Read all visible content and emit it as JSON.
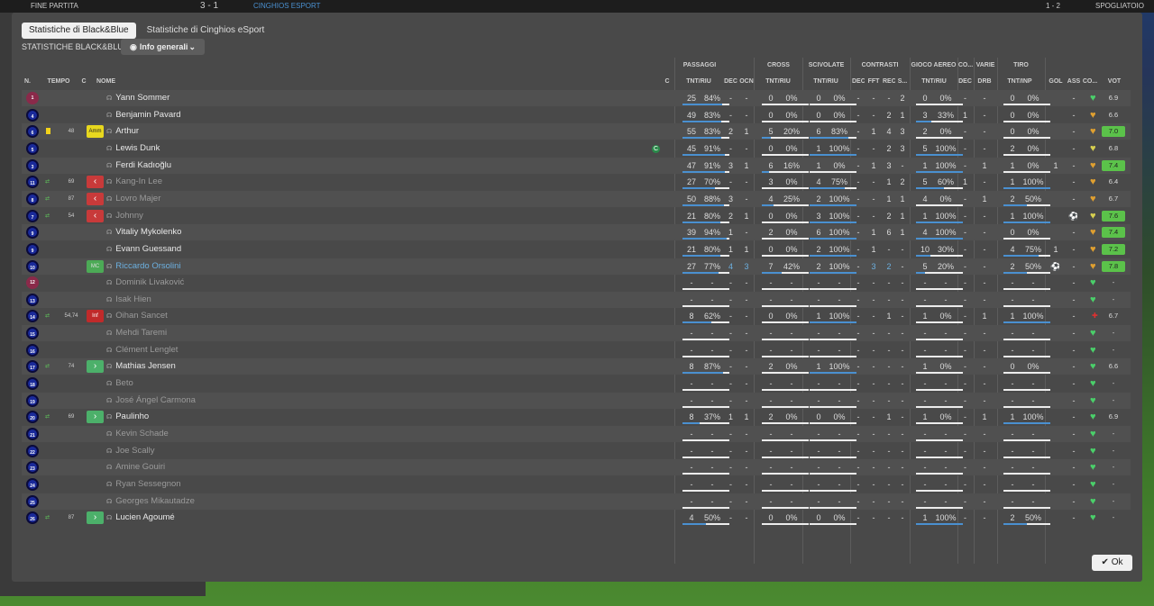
{
  "topbar": {
    "left": "FINE PARTITA",
    "score": "3 - 1",
    "team2": "CINGHIOS ESPORT",
    "sep": "1 - 2",
    "right": "SPOGLIATOIO"
  },
  "tabs": [
    "Statistiche di Black&Blue",
    "Statistiche di Cinghios eSport"
  ],
  "subtitle": "STATISTICHE BLACK&BLUE",
  "dropdown": "Info generali",
  "group_headers": {
    "passaggi": "PASSAGGI",
    "cross": "CROSS",
    "scivolate": "SCIVOLATE",
    "contrasti": "CONTRASTI",
    "gioco_aereo": "GIOCO AEREO",
    "co": "CO...",
    "varie": "VARIE",
    "tiro": "TIRO"
  },
  "headers": {
    "n": "N.",
    "tempo": "TEMPO",
    "c1": "C",
    "nome": "NOME",
    "c2": "C",
    "pass": "TNT/RIU",
    "dec": "DEC",
    "ocn": "OCN",
    "cross": "TNT/RIU",
    "sciv": "TNT/RIU",
    "cdec": "DEC",
    "fft": "FFT",
    "rec": "REC",
    "s": "S...",
    "aer": "TNT/RIU",
    "adec": "DEC",
    "drb": "DRB",
    "tiro": "TNT/INP",
    "gol": "GOL",
    "ass": "ASS",
    "co": "CO...",
    "vot": "VOT"
  },
  "ok_label": "Ok",
  "players": [
    {
      "n": "1",
      "name": "Yann Sommer",
      "kind": "gk",
      "pass": [
        "25",
        "84%"
      ],
      "dec": "-",
      "ocn": "-",
      "cross": [
        "0",
        "0%"
      ],
      "sciv": [
        "0",
        "0%"
      ],
      "cdec": "-",
      "fft": "-",
      "rec": "-",
      "s": "2",
      "aer": [
        "0",
        "0%"
      ],
      "adec": "-",
      "drb": "-",
      "tiro": [
        "0",
        "0%"
      ],
      "gol": "",
      "ass": "-",
      "heart": "green",
      "vote": "6.9",
      "hi": false
    },
    {
      "n": "4",
      "name": "Benjamin Pavard",
      "kind": "out",
      "pass": [
        "49",
        "83%"
      ],
      "dec": "-",
      "ocn": "-",
      "cross": [
        "0",
        "0%"
      ],
      "sciv": [
        "0",
        "0%"
      ],
      "cdec": "-",
      "fft": "-",
      "rec": "2",
      "s": "1",
      "aer": [
        "3",
        "33%"
      ],
      "adec": "1",
      "drb": "-",
      "tiro": [
        "0",
        "0%"
      ],
      "gol": "",
      "ass": "-",
      "heart": "orange",
      "vote": "6.6",
      "hi": false
    },
    {
      "n": "6",
      "name": "Arthur",
      "kind": "out",
      "yellow": true,
      "tm": "48",
      "badge": "Amm",
      "badgeType": "amm",
      "pass": [
        "55",
        "83%"
      ],
      "dec": "2",
      "ocn": "1",
      "cross": [
        "5",
        "20%"
      ],
      "sciv": [
        "6",
        "83%"
      ],
      "cdec": "-",
      "fft": "1",
      "rec": "4",
      "s": "3",
      "aer": [
        "2",
        "0%"
      ],
      "adec": "-",
      "drb": "-",
      "tiro": [
        "0",
        "0%"
      ],
      "gol": "",
      "ass": "-",
      "heart": "orange",
      "vote": "7.0",
      "hi": true
    },
    {
      "n": "5",
      "name": "Lewis Dunk",
      "kind": "out",
      "capt": "C",
      "pass": [
        "45",
        "91%"
      ],
      "dec": "-",
      "ocn": "-",
      "cross": [
        "0",
        "0%"
      ],
      "sciv": [
        "1",
        "100%"
      ],
      "cdec": "-",
      "fft": "-",
      "rec": "2",
      "s": "3",
      "aer": [
        "5",
        "100%"
      ],
      "adec": "-",
      "drb": "-",
      "tiro": [
        "2",
        "0%"
      ],
      "gol": "",
      "ass": "-",
      "heart": "yellow",
      "vote": "6.8",
      "hi": false
    },
    {
      "n": "3",
      "name": "Ferdi Kadıoğlu",
      "kind": "out",
      "pass": [
        "47",
        "91%"
      ],
      "dec": "3",
      "ocn": "1",
      "cross": [
        "6",
        "16%"
      ],
      "sciv": [
        "1",
        "0%"
      ],
      "cdec": "-",
      "fft": "1",
      "rec": "3",
      "s": "-",
      "aer": [
        "1",
        "100%"
      ],
      "adec": "-",
      "drb": "1",
      "tiro": [
        "1",
        "0%"
      ],
      "gol": "1",
      "ass": "-",
      "heart": "orange",
      "vote": "7.4",
      "hi": true
    },
    {
      "n": "11",
      "name": "Kang-In Lee",
      "kind": "out",
      "sub": true,
      "swap": true,
      "tm": "69",
      "badgeType": "out",
      "badge": "‹",
      "pass": [
        "27",
        "70%"
      ],
      "dec": "-",
      "ocn": "-",
      "cross": [
        "3",
        "0%"
      ],
      "sciv": [
        "4",
        "75%"
      ],
      "cdec": "-",
      "fft": "-",
      "rec": "1",
      "s": "2",
      "aer": [
        "5",
        "60%"
      ],
      "adec": "1",
      "drb": "-",
      "tiro": [
        "1",
        "100%"
      ],
      "gol": "",
      "ass": "-",
      "heart": "orange",
      "vote": "6.4",
      "hi": false
    },
    {
      "n": "8",
      "name": "Lovro Majer",
      "kind": "out",
      "sub": true,
      "swap": true,
      "tm": "87",
      "badgeType": "out",
      "badge": "‹",
      "pass": [
        "50",
        "88%"
      ],
      "dec": "3",
      "ocn": "-",
      "cross": [
        "4",
        "25%"
      ],
      "sciv": [
        "2",
        "100%"
      ],
      "cdec": "-",
      "fft": "-",
      "rec": "1",
      "s": "1",
      "aer": [
        "4",
        "0%"
      ],
      "adec": "-",
      "drb": "1",
      "tiro": [
        "2",
        "50%"
      ],
      "gol": "",
      "ass": "-",
      "heart": "orange",
      "vote": "6.7",
      "hi": false
    },
    {
      "n": "7",
      "name": "Johnny",
      "kind": "out",
      "sub": true,
      "swap": true,
      "tm": "54",
      "badgeType": "out",
      "badge": "‹",
      "pass": [
        "21",
        "80%"
      ],
      "dec": "2",
      "ocn": "1",
      "cross": [
        "0",
        "0%"
      ],
      "sciv": [
        "3",
        "100%"
      ],
      "cdec": "-",
      "fft": "-",
      "rec": "2",
      "s": "1",
      "aer": [
        "1",
        "100%"
      ],
      "adec": "-",
      "drb": "-",
      "tiro": [
        "1",
        "100%"
      ],
      "gol": "",
      "ass": "⚽",
      "heart": "yellow",
      "vote": "7.6",
      "hi": true
    },
    {
      "n": "9",
      "name": "Vitaliy Mykolenko",
      "kind": "out",
      "pass": [
        "39",
        "94%"
      ],
      "dec": "1",
      "ocn": "-",
      "cross": [
        "2",
        "0%"
      ],
      "sciv": [
        "6",
        "100%"
      ],
      "cdec": "-",
      "fft": "1",
      "rec": "6",
      "s": "1",
      "aer": [
        "4",
        "100%"
      ],
      "adec": "-",
      "drb": "-",
      "tiro": [
        "0",
        "0%"
      ],
      "gol": "",
      "ass": "-",
      "heart": "orange",
      "vote": "7.4",
      "hi": true
    },
    {
      "n": "9",
      "name": "Evann Guessand",
      "kind": "out",
      "pass": [
        "21",
        "80%"
      ],
      "dec": "1",
      "ocn": "1",
      "cross": [
        "0",
        "0%"
      ],
      "sciv": [
        "2",
        "100%"
      ],
      "cdec": "-",
      "fft": "1",
      "rec": "-",
      "s": "-",
      "aer": [
        "10",
        "30%"
      ],
      "adec": "-",
      "drb": "-",
      "tiro": [
        "4",
        "75%"
      ],
      "gol": "1",
      "ass": "-",
      "heart": "orange",
      "vote": "7.2",
      "hi": true
    },
    {
      "n": "10",
      "name": "Riccardo Orsolini",
      "kind": "out",
      "hl": true,
      "badgeType": "mc",
      "badge": "MC",
      "pass": [
        "27",
        "77%"
      ],
      "dec": "4",
      "ocn": "3",
      "cross": [
        "7",
        "42%"
      ],
      "sciv": [
        "2",
        "100%"
      ],
      "cdec": "-",
      "fft": "3",
      "rec": "2",
      "s": "-",
      "aer": [
        "5",
        "20%"
      ],
      "adec": "-",
      "drb": "-",
      "tiro": [
        "2",
        "50%"
      ],
      "gol": "⚽",
      "ass": "-",
      "heart": "orange",
      "vote": "7.8",
      "hi": true
    },
    {
      "n": "12",
      "name": "Dominik Livaković",
      "kind": "gk",
      "sub": true,
      "empty": true,
      "heart": "green",
      "vote": "-"
    },
    {
      "n": "13",
      "name": "Isak Hien",
      "kind": "out",
      "sub": true,
      "empty": true,
      "heart": "green",
      "vote": "-"
    },
    {
      "n": "14",
      "name": "Oihan Sancet",
      "kind": "out",
      "sub": true,
      "swap": true,
      "tm": "54,74",
      "badgeType": "inf",
      "badge": "Inf",
      "pass": [
        "8",
        "62%"
      ],
      "dec": "-",
      "ocn": "-",
      "cross": [
        "0",
        "0%"
      ],
      "sciv": [
        "1",
        "100%"
      ],
      "cdec": "-",
      "fft": "-",
      "rec": "1",
      "s": "-",
      "aer": [
        "1",
        "0%"
      ],
      "adec": "-",
      "drb": "1",
      "tiro": [
        "1",
        "100%"
      ],
      "gol": "",
      "ass": "-",
      "heart": "red",
      "vote": "6.7",
      "hi": false
    },
    {
      "n": "15",
      "name": "Mehdi Taremi",
      "kind": "out",
      "sub": true,
      "empty": true,
      "heart": "green",
      "vote": "-"
    },
    {
      "n": "16",
      "name": "Clément Lenglet",
      "kind": "out",
      "sub": true,
      "empty": true,
      "heart": "green",
      "vote": "-"
    },
    {
      "n": "17",
      "name": "Mathias Jensen",
      "kind": "out",
      "swap": true,
      "tm": "74",
      "badgeType": "in",
      "badge": "›",
      "pass": [
        "8",
        "87%"
      ],
      "dec": "-",
      "ocn": "-",
      "cross": [
        "2",
        "0%"
      ],
      "sciv": [
        "1",
        "100%"
      ],
      "cdec": "-",
      "fft": "-",
      "rec": "-",
      "s": "-",
      "aer": [
        "1",
        "0%"
      ],
      "adec": "-",
      "drb": "-",
      "tiro": [
        "0",
        "0%"
      ],
      "gol": "",
      "ass": "-",
      "heart": "green",
      "vote": "6.6",
      "hi": false
    },
    {
      "n": "18",
      "name": "Beto",
      "kind": "out",
      "sub": true,
      "empty": true,
      "heart": "green",
      "vote": "-"
    },
    {
      "n": "19",
      "name": "José Ángel Carmona",
      "kind": "out",
      "sub": true,
      "empty": true,
      "heart": "green",
      "vote": "-"
    },
    {
      "n": "20",
      "name": "Paulinho",
      "kind": "out",
      "swap": true,
      "tm": "69",
      "badgeType": "in",
      "badge": "›",
      "pass": [
        "8",
        "37%"
      ],
      "dec": "1",
      "ocn": "1",
      "cross": [
        "2",
        "0%"
      ],
      "sciv": [
        "0",
        "0%"
      ],
      "cdec": "-",
      "fft": "-",
      "rec": "1",
      "s": "-",
      "aer": [
        "1",
        "0%"
      ],
      "adec": "-",
      "drb": "1",
      "tiro": [
        "1",
        "100%"
      ],
      "gol": "",
      "ass": "-",
      "heart": "green",
      "vote": "6.9",
      "hi": false
    },
    {
      "n": "21",
      "name": "Kevin Schade",
      "kind": "out",
      "sub": true,
      "empty": true,
      "heart": "green",
      "vote": "-"
    },
    {
      "n": "22",
      "name": "Joe Scally",
      "kind": "out",
      "sub": true,
      "empty": true,
      "heart": "green",
      "vote": "-"
    },
    {
      "n": "23",
      "name": "Amine Gouiri",
      "kind": "out",
      "sub": true,
      "empty": true,
      "heart": "green",
      "vote": "-"
    },
    {
      "n": "24",
      "name": "Ryan Sessegnon",
      "kind": "out",
      "sub": true,
      "empty": true,
      "heart": "green",
      "vote": "-"
    },
    {
      "n": "25",
      "name": "Georges Mikautadze",
      "kind": "out",
      "sub": true,
      "empty": true,
      "heart": "green",
      "vote": "-"
    },
    {
      "n": "26",
      "name": "Lucien Agoumé",
      "kind": "out",
      "swap": true,
      "tm": "87",
      "badgeType": "in",
      "badge": "›",
      "pass": [
        "4",
        "50%"
      ],
      "dec": "-",
      "ocn": "-",
      "cross": [
        "0",
        "0%"
      ],
      "sciv": [
        "0",
        "0%"
      ],
      "cdec": "-",
      "fft": "-",
      "rec": "-",
      "s": "-",
      "aer": [
        "1",
        "100%"
      ],
      "adec": "-",
      "drb": "-",
      "tiro": [
        "2",
        "50%"
      ],
      "gol": "",
      "ass": "-",
      "heart": "green",
      "vote": "-",
      "hi": false
    }
  ]
}
